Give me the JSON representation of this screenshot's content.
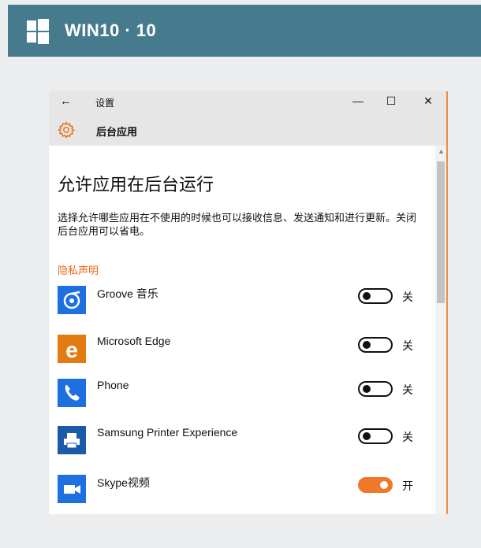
{
  "banner": {
    "title": "WIN10 · 10",
    "logo_icon": "windows-logo-icon"
  },
  "window": {
    "back_icon": "←",
    "title": "设置",
    "minimize_icon": "—",
    "maximize_icon": "☐",
    "close_icon": "✕",
    "section_title": "后台应用",
    "section_icon": "gear-icon"
  },
  "page": {
    "heading": "允许应用在后台运行",
    "description": "选择允许哪些应用在不使用的时候也可以接收信息、发送通知和进行更新。关闭后台应用可以省电。",
    "privacy_link": "隐私声明"
  },
  "apps": [
    {
      "name": "Groove 音乐",
      "icon": "groove-music-icon",
      "state": "关",
      "on": false,
      "color": "#1e6fe0"
    },
    {
      "name": "Microsoft Edge",
      "icon": "microsoft-edge-icon",
      "state": "关",
      "on": false,
      "color": "#e37c10"
    },
    {
      "name": "Phone",
      "icon": "phone-icon",
      "state": "关",
      "on": false,
      "color": "#1e6fe0"
    },
    {
      "name": "Samsung Printer Experience",
      "icon": "printer-icon",
      "state": "关",
      "on": false,
      "color": "#1a5aa8"
    },
    {
      "name": "Skype视频",
      "icon": "skype-video-icon",
      "state": "开",
      "on": true,
      "color": "#1e6fe0"
    }
  ],
  "colors": {
    "accent": "#f0782a",
    "banner": "#467b8e",
    "link": "#ea6a12"
  }
}
